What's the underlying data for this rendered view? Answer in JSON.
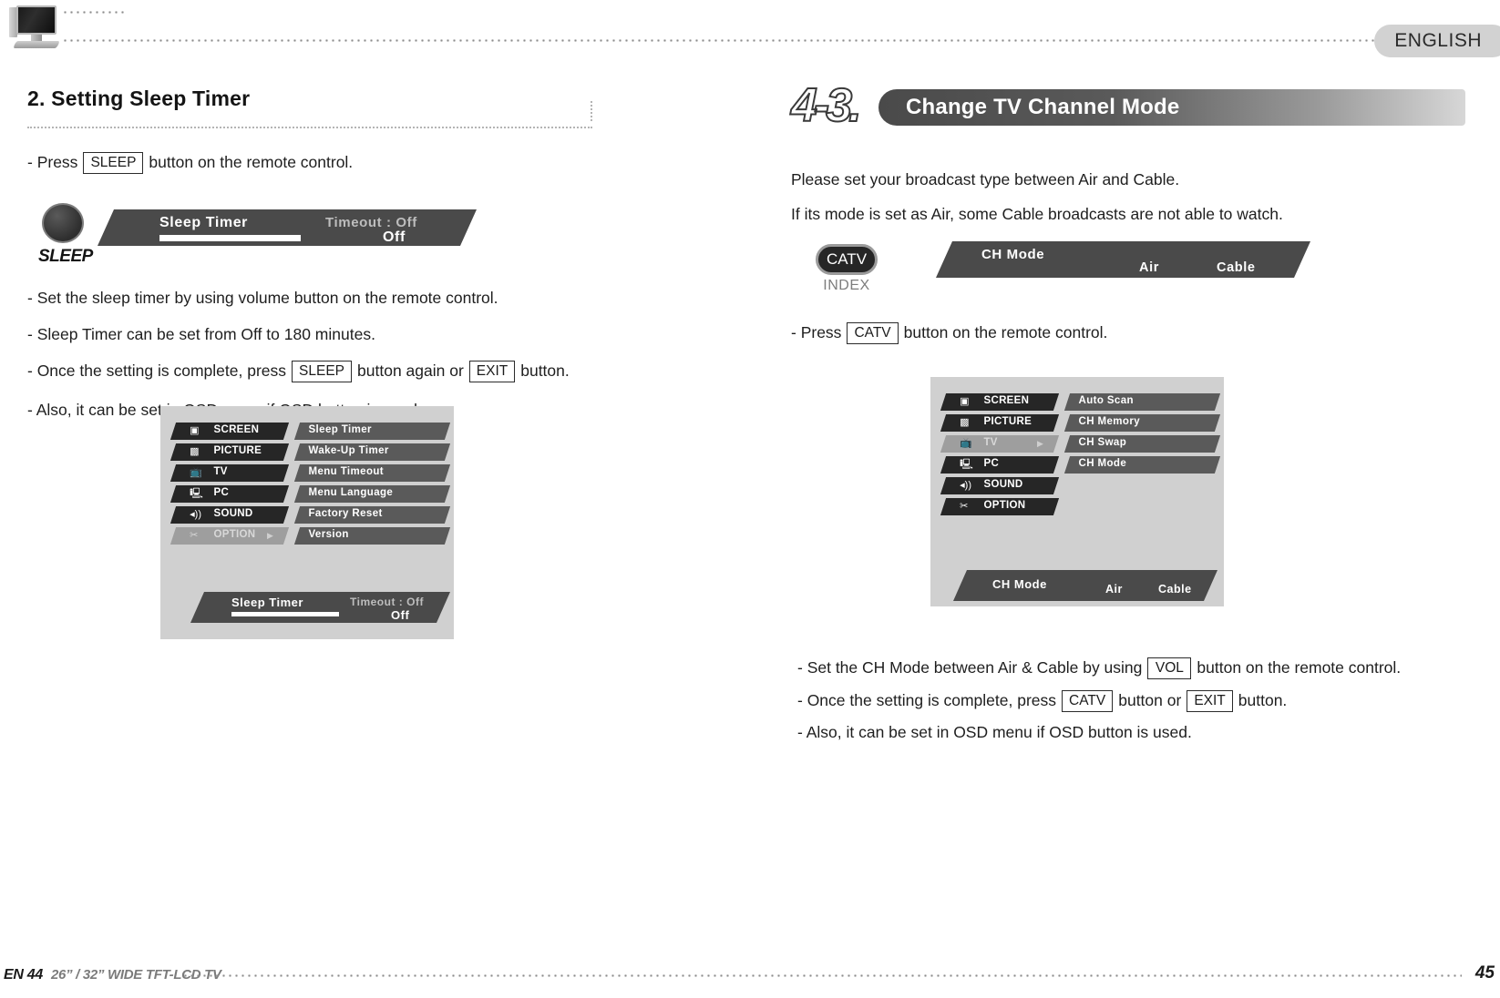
{
  "header": {
    "language_tab": "ENGLISH",
    "tv_icon": "tv-monitor-icon"
  },
  "left_column": {
    "section_title": "2. Setting Sleep Timer",
    "intro": {
      "prefix": "- Press",
      "key": "SLEEP",
      "suffix": "button on the remote control."
    },
    "remote_key": {
      "label": "SLEEP",
      "icon": "round-button-icon"
    },
    "osd_bar": {
      "label": "Sleep Timer",
      "timeout_label": "Timeout : Off",
      "value": "Off"
    },
    "bullets": [
      "- Set the sleep timer by using volume button on the remote control.",
      "- Sleep Timer can be set from Off to 180 minutes."
    ],
    "bullet_keys": {
      "prefix": "- Once the setting is complete, press",
      "key1": "SLEEP",
      "middle": "button again or",
      "key2": "EXIT",
      "suffix": "button."
    },
    "bullet_last": "-  Also, it can be set in OSD menu if OSD button is used.",
    "osd_panel": {
      "menu": [
        {
          "label": "SCREEN",
          "icon": "screen-icon",
          "state": "normal",
          "arrow": false
        },
        {
          "label": "PICTURE",
          "icon": "picture-icon",
          "state": "normal",
          "arrow": false
        },
        {
          "label": "TV",
          "icon": "tv-icon",
          "state": "normal",
          "arrow": false
        },
        {
          "label": "PC",
          "icon": "pc-icon",
          "state": "normal",
          "arrow": false
        },
        {
          "label": "SOUND",
          "icon": "sound-icon",
          "state": "normal",
          "arrow": false
        },
        {
          "label": "OPTION",
          "icon": "option-icon",
          "state": "selected",
          "arrow": true
        }
      ],
      "submenu": [
        "Sleep Timer",
        "Wake-Up Timer",
        "Menu Timeout",
        "Menu Language",
        "Factory Reset",
        "Version"
      ],
      "footbar": {
        "label": "Sleep Timer",
        "timeout_label": "Timeout : Off",
        "value": "Off"
      }
    }
  },
  "right_column": {
    "section_number": "4-3.",
    "section_title": "Change TV Channel Mode",
    "paragraphs": [
      "Please set your broadcast type between Air and Cable.",
      "If its mode is set as Air, some Cable broadcasts are not able to watch."
    ],
    "remote_key": {
      "label": "CATV",
      "sublabel": "INDEX"
    },
    "osd_bar": {
      "label": "CH Mode",
      "option_air": "Air",
      "option_cable": "Cable"
    },
    "press_line": {
      "prefix": "-  Press",
      "key": "CATV",
      "suffix": "button on the remote control."
    },
    "osd_panel": {
      "menu": [
        {
          "label": "SCREEN",
          "icon": "screen-icon",
          "state": "normal",
          "arrow": false
        },
        {
          "label": "PICTURE",
          "icon": "picture-icon",
          "state": "normal",
          "arrow": false
        },
        {
          "label": "TV",
          "icon": "tv-icon",
          "state": "selected",
          "arrow": true
        },
        {
          "label": "PC",
          "icon": "pc-icon",
          "state": "normal",
          "arrow": false
        },
        {
          "label": "SOUND",
          "icon": "sound-icon",
          "state": "normal",
          "arrow": false
        },
        {
          "label": "OPTION",
          "icon": "option-icon",
          "state": "normal",
          "arrow": false
        }
      ],
      "submenu": [
        "Auto Scan",
        "CH Memory",
        "CH Swap",
        "CH Mode"
      ],
      "footbar": {
        "label": "CH Mode",
        "option_air": "Air",
        "option_cable": "Cable"
      }
    },
    "bullets": {
      "b1": {
        "prefix": "- Set the CH Mode between Air & Cable by using",
        "key": "VOL",
        "suffix": "button on the remote control."
      },
      "b2": {
        "prefix": "- Once the setting is complete, press",
        "key1": "CATV",
        "middle": "button or",
        "key2": "EXIT",
        "suffix": "button."
      },
      "b3": "- Also, it can be set in OSD menu if OSD button is used."
    }
  },
  "footer": {
    "en_page": "EN 44",
    "model": "26” / 32” WIDE TFT-LCD TV",
    "page_number": "45"
  },
  "colors": {
    "osd_dark": "#4a4a4a",
    "menu_dark": "#262626",
    "submenu_gray": "#5a5a5a",
    "panel_bg": "#d0d0d0",
    "accent_gray": "#7b7b7b"
  }
}
